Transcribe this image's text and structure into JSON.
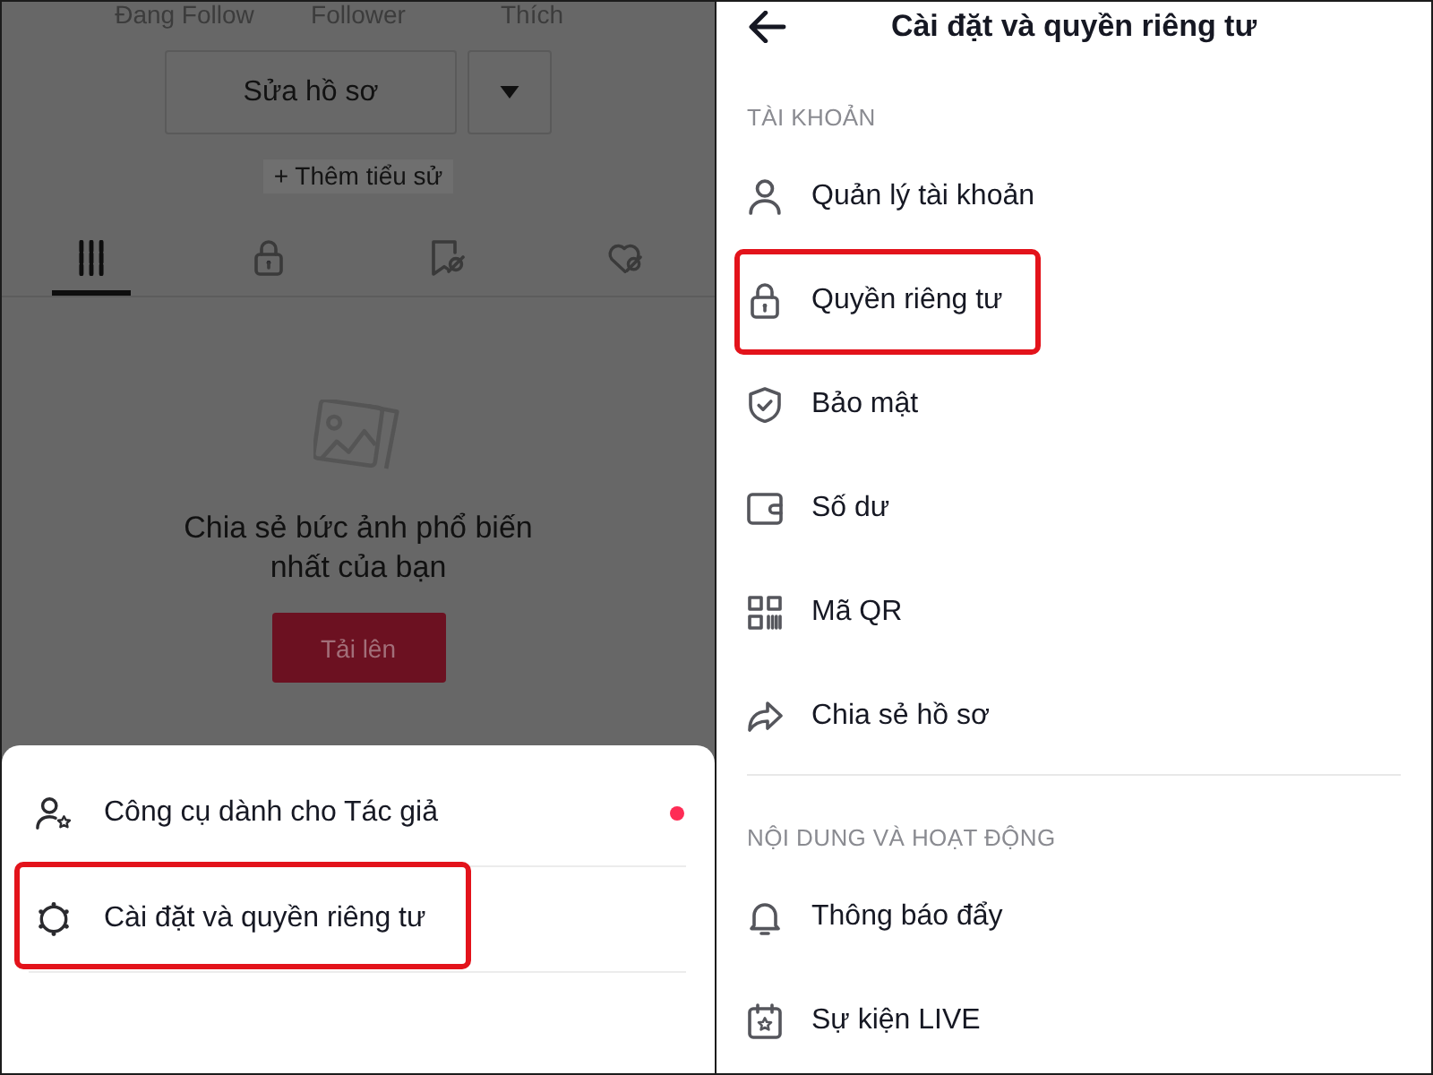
{
  "profile": {
    "stats": [
      {
        "label": "Đang Follow"
      },
      {
        "label": "Follower"
      },
      {
        "label": "Thích"
      }
    ],
    "edit_button": "Sửa hồ sơ",
    "add_bio": "+ Thêm tiểu sử",
    "tabs": [
      {
        "kind": "videos",
        "selected": true
      },
      {
        "kind": "private",
        "selected": false
      },
      {
        "kind": "saved",
        "selected": false
      },
      {
        "kind": "liked",
        "selected": false
      }
    ],
    "empty_state": {
      "message": "Chia sẻ bức ảnh phổ biến nhất của bạn",
      "button": "Tải lên"
    }
  },
  "sheet": {
    "items": [
      {
        "kind": "creator-tools",
        "label": "Công cụ dành cho Tác giả",
        "dot": true,
        "highlighted": false
      },
      {
        "kind": "settings",
        "label": "Cài đặt và quyền riêng tư",
        "dot": false,
        "highlighted": true
      }
    ]
  },
  "settings": {
    "title": "Cài đặt và quyền riêng tư",
    "sections": [
      {
        "heading": "TÀI KHOẢN",
        "items": [
          {
            "kind": "account",
            "label": "Quản lý tài khoản",
            "highlighted": false
          },
          {
            "kind": "privacy",
            "label": "Quyền riêng tư",
            "highlighted": true
          },
          {
            "kind": "security",
            "label": "Bảo mật",
            "highlighted": false
          },
          {
            "kind": "balance",
            "label": "Số dư",
            "highlighted": false
          },
          {
            "kind": "qr-code",
            "label": "Mã QR",
            "highlighted": false
          },
          {
            "kind": "share-profile",
            "label": "Chia sẻ hồ sơ",
            "highlighted": false
          }
        ]
      },
      {
        "heading": "NỘI DUNG VÀ HOẠT ĐỘNG",
        "items": [
          {
            "kind": "push-notifications",
            "label": "Thông báo đẩy",
            "highlighted": false
          },
          {
            "kind": "live-events",
            "label": "Sự kiện LIVE",
            "highlighted": false
          }
        ]
      }
    ]
  }
}
